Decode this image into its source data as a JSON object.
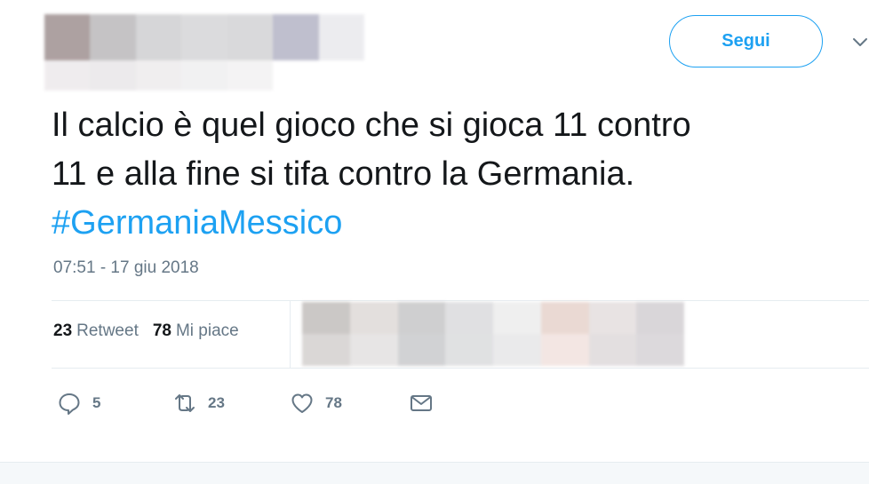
{
  "header": {
    "follow_label": "Segui"
  },
  "tweet": {
    "text_lines": [
      "Il calcio è quel gioco che si gioca 11 contro",
      "11 e alla fine si tifa contro la Germania."
    ],
    "hashtag": "#GermaniaMessico",
    "timestamp": "07:51 - 17 giu 2018"
  },
  "stats": {
    "retweet_count": "23",
    "retweet_label": "Retweet",
    "like_count": "78",
    "like_label": "Mi piace"
  },
  "actions": {
    "reply_count": "5",
    "retweet_count": "23",
    "like_count": "78"
  },
  "colors": {
    "accent": "#1da1f2",
    "secondary_text": "#657786",
    "divider": "#e6ecf0"
  },
  "blur_palettes": {
    "header": [
      [
        "#a99c9c",
        "#c2c0c2",
        "#d4d4d6",
        "#dadadc",
        "#d8d8da",
        "#bcbccc",
        "#ececef"
      ],
      [
        "#efecee",
        "#ebe9eb",
        "#f0eeef",
        "#f1f1f2",
        "#f4f3f4",
        "#ffffff",
        "#ffffff"
      ]
    ],
    "likers": [
      [
        "#cbc8c6",
        "#e3dfdd",
        "#cfcfd0",
        "#e0e0e2",
        "#efefef",
        "#ead9d3",
        "#e8e3e3",
        "#d9d6d9"
      ],
      [
        "#dad7d6",
        "#e7e5e5",
        "#d1d2d4",
        "#e0e1e2",
        "#eaeaeb",
        "#f3e6e3",
        "#e3dfe0",
        "#dcd9dc"
      ]
    ]
  }
}
